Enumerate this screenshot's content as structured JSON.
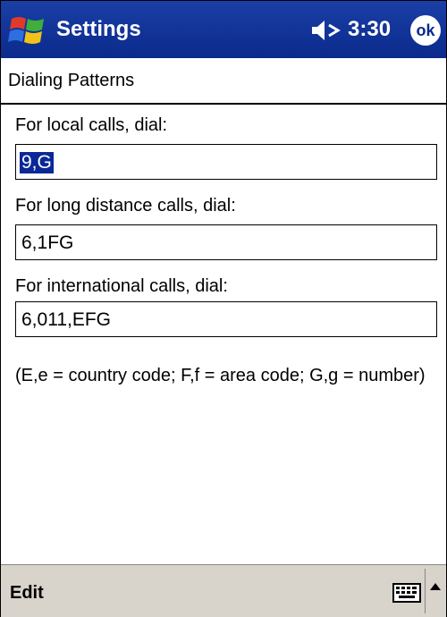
{
  "titlebar": {
    "app_title": "Settings",
    "time": "3:30",
    "ok_label": "ok",
    "start_icon": "windows-flag-icon",
    "volume_icon": "speaker-icon"
  },
  "page": {
    "heading": "Dialing Patterns"
  },
  "fields": [
    {
      "label": "For local calls, dial:",
      "value": "9,G",
      "selected": true
    },
    {
      "label": "For long distance calls, dial:",
      "value": "6,1FG",
      "selected": false
    },
    {
      "label": "For international calls, dial:",
      "value": "6,011,EFG",
      "selected": false
    }
  ],
  "help_text": "(E,e = country code; F,f = area code; G,g = number)",
  "menubar": {
    "edit_label": "Edit",
    "keyboard_icon": "keyboard-icon",
    "sip_arrow_icon": "arrow-up-icon"
  },
  "colors": {
    "titlebar": "#0b2a8c",
    "selection": "#0a2896",
    "menubar": "#d8d4cc"
  }
}
